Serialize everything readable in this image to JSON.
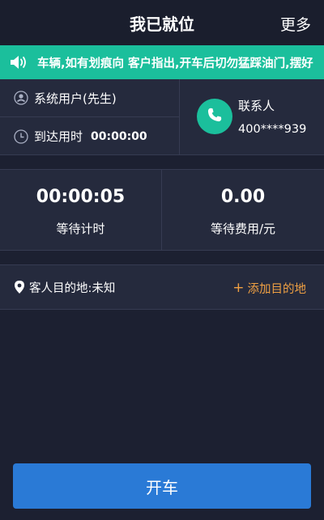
{
  "header": {
    "title": "我已就位",
    "more_label": "更多"
  },
  "notice": {
    "icon": "speaker-icon",
    "text": "车辆,如有划痕向 客户指出,开车后切勿猛踩油门,摆好"
  },
  "info": {
    "user_icon": "user-icon",
    "user_label": "系统用户(先生)",
    "clock_icon": "clock-icon",
    "arrival_label": "到达用时",
    "arrival_time": "00:00:00",
    "phone_icon": "phone-icon",
    "contact_label": "联系人",
    "contact_phone": "400****939"
  },
  "timers": {
    "wait_time_value": "00:00:05",
    "wait_time_label": "等待计时",
    "wait_fee_value": "0.00",
    "wait_fee_label": "等待费用/元"
  },
  "destination": {
    "pin_icon": "location-pin-icon",
    "label": "客人目的地:未知",
    "add_label": "添加目的地",
    "add_plus": "+"
  },
  "actions": {
    "start_label": "开车"
  },
  "colors": {
    "accent_green": "#1bbf9c",
    "primary_blue": "#2a7ad6",
    "link_orange": "#f0a043",
    "background": "#1c2031",
    "panel": "#252a3d"
  }
}
